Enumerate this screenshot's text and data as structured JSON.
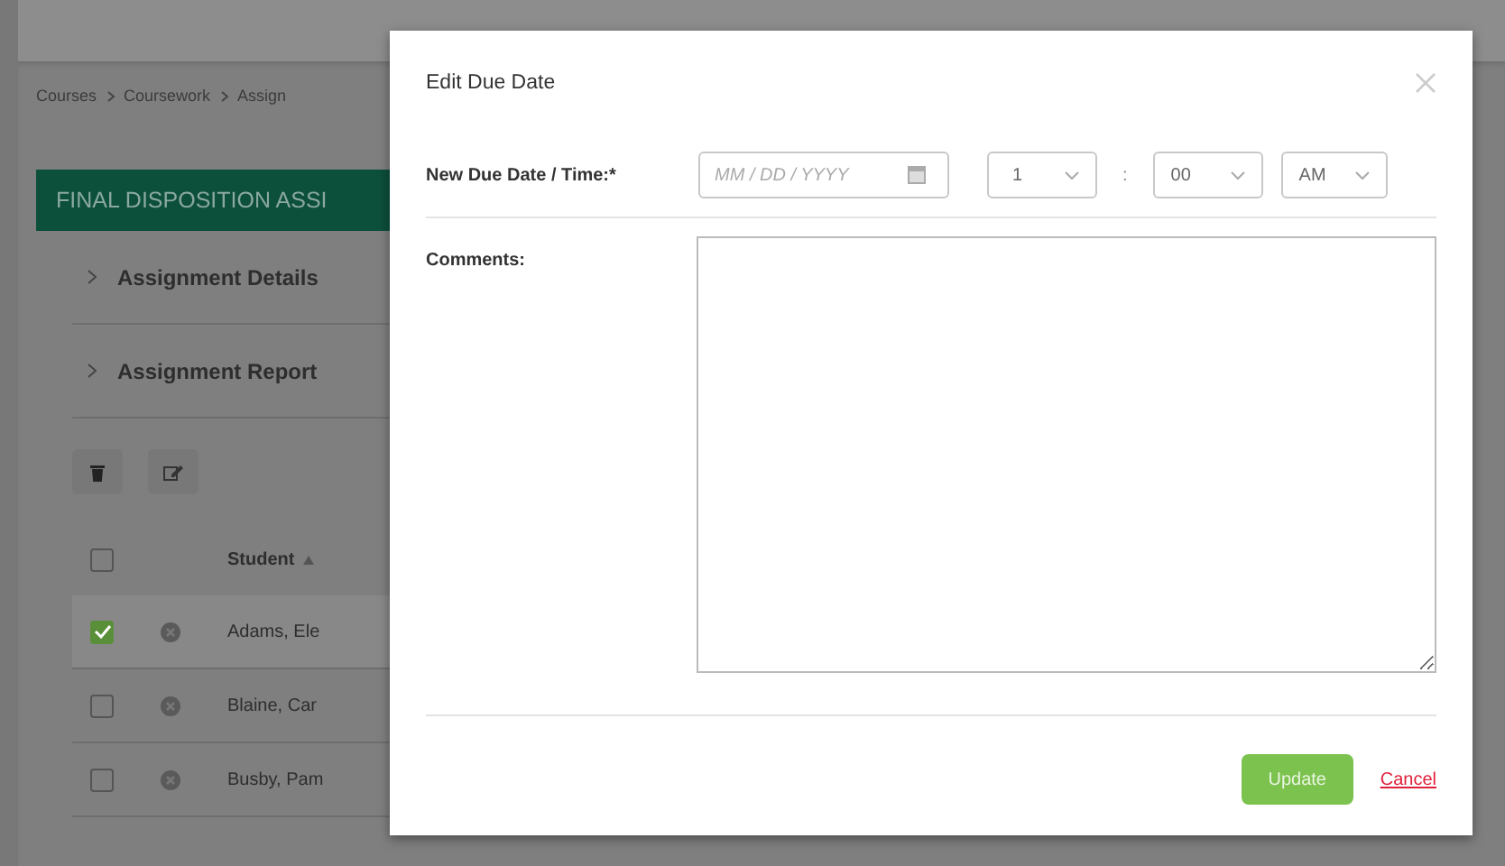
{
  "breadcrumb": [
    "Courses",
    "Coursework",
    "Assign"
  ],
  "assignment_title": "FINAL DISPOSITION ASSI",
  "sections": [
    {
      "label": "Assignment Details",
      "expanded": false
    },
    {
      "label": "Assignment Report",
      "expanded": false
    }
  ],
  "table": {
    "header": {
      "checked": false,
      "student": "Student"
    },
    "rows": [
      {
        "checked": true,
        "student": "Adams, Ele"
      },
      {
        "checked": false,
        "student": "Blaine, Car"
      },
      {
        "checked": false,
        "student": "Busby, Pam"
      }
    ]
  },
  "dialog": {
    "title": "Edit Due Date",
    "due_label": "New Due Date / Time:*",
    "date": {
      "placeholder": "MM / DD / YYYY"
    },
    "hour": "1",
    "separator": ":",
    "minute": "00",
    "period": "AM",
    "comments_label": "Comments:",
    "buttons": {
      "update": "Update",
      "cancel": "Cancel"
    }
  }
}
